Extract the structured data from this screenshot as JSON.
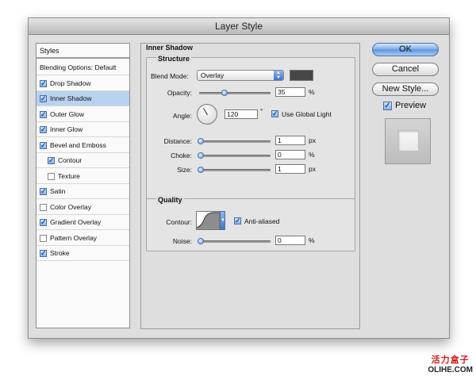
{
  "window": {
    "title": "Layer Style"
  },
  "styles_panel": {
    "header": "Styles",
    "items": [
      {
        "label": "Blending Options: Default",
        "has_checkbox": false,
        "checked": false,
        "selected": false,
        "indent": 0
      },
      {
        "label": "Drop Shadow",
        "has_checkbox": true,
        "checked": true,
        "selected": false,
        "indent": 0
      },
      {
        "label": "Inner Shadow",
        "has_checkbox": true,
        "checked": true,
        "selected": true,
        "indent": 0
      },
      {
        "label": "Outer Glow",
        "has_checkbox": true,
        "checked": true,
        "selected": false,
        "indent": 0
      },
      {
        "label": "Inner Glow",
        "has_checkbox": true,
        "checked": true,
        "selected": false,
        "indent": 0
      },
      {
        "label": "Bevel and Emboss",
        "has_checkbox": true,
        "checked": true,
        "selected": false,
        "indent": 0
      },
      {
        "label": "Contour",
        "has_checkbox": true,
        "checked": true,
        "selected": false,
        "indent": 1
      },
      {
        "label": "Texture",
        "has_checkbox": true,
        "checked": false,
        "selected": false,
        "indent": 1
      },
      {
        "label": "Satin",
        "has_checkbox": true,
        "checked": true,
        "selected": false,
        "indent": 0
      },
      {
        "label": "Color Overlay",
        "has_checkbox": true,
        "checked": false,
        "selected": false,
        "indent": 0
      },
      {
        "label": "Gradient Overlay",
        "has_checkbox": true,
        "checked": true,
        "selected": false,
        "indent": 0
      },
      {
        "label": "Pattern Overlay",
        "has_checkbox": true,
        "checked": false,
        "selected": false,
        "indent": 0
      },
      {
        "label": "Stroke",
        "has_checkbox": true,
        "checked": true,
        "selected": false,
        "indent": 0
      }
    ]
  },
  "inner_shadow": {
    "title": "Inner Shadow",
    "structure": {
      "title": "Structure",
      "blend_mode_label": "Blend Mode:",
      "blend_mode_value": "Overlay",
      "shadow_color": "#474747",
      "opacity_label": "Opacity:",
      "opacity_value": "35",
      "opacity_fraction": 0.35,
      "opacity_unit": "%",
      "angle_label": "Angle:",
      "angle_value": "120",
      "angle_unit": "°",
      "use_global_light_label": "Use Global Light",
      "use_global_light_checked": true,
      "distance_label": "Distance:",
      "distance_value": "1",
      "distance_unit": "px",
      "choke_label": "Choke:",
      "choke_value": "0",
      "choke_unit": "%",
      "size_label": "Size:",
      "size_value": "1",
      "size_unit": "px"
    },
    "quality": {
      "title": "Quality",
      "contour_label": "Contour:",
      "anti_aliased_label": "Anti-aliased",
      "anti_aliased_checked": true,
      "noise_label": "Noise:",
      "noise_value": "0",
      "noise_unit": "%"
    }
  },
  "buttons": {
    "ok": "OK",
    "cancel": "Cancel",
    "new_style": "New Style...",
    "preview_label": "Preview",
    "preview_checked": true
  },
  "watermark": {
    "line1": "活力盒子",
    "line2": "OLIHE.COM"
  }
}
